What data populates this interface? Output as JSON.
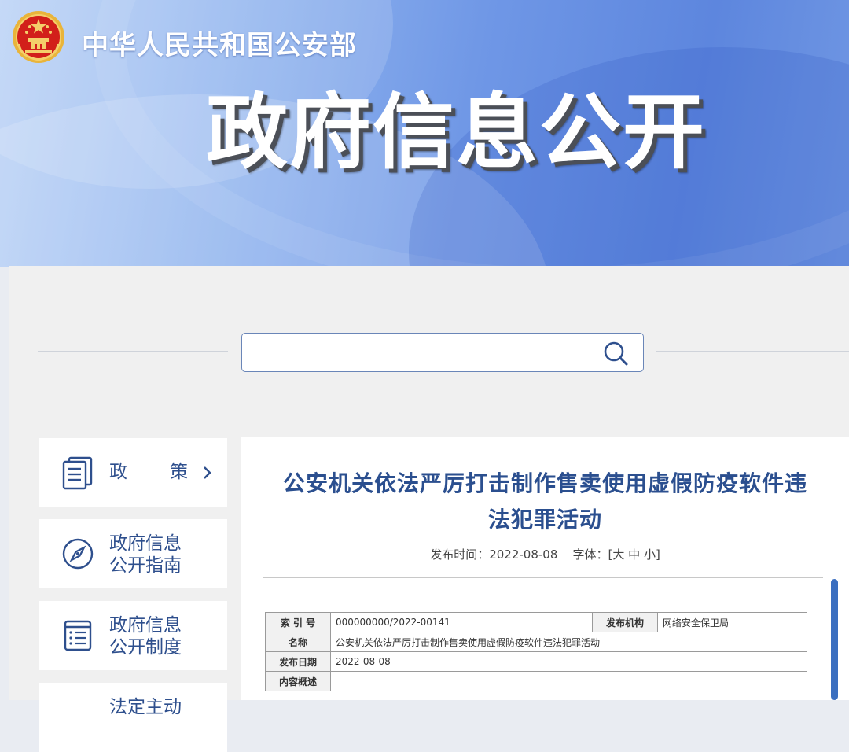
{
  "header": {
    "site_name": "中华人民共和国公安部",
    "banner_title": "政府信息公开"
  },
  "search": {
    "placeholder": ""
  },
  "nav": {
    "items": [
      {
        "label_parts": [
          "政",
          "策"
        ]
      },
      {
        "line1": "政府信息",
        "line2": "公开指南"
      },
      {
        "line1": "政府信息",
        "line2": "公开制度"
      },
      {
        "line1": "法定主动"
      }
    ]
  },
  "article": {
    "title_line1": "公安机关依法严厉打击制作售卖使用虚假防疫软件违",
    "title_line2": "法犯罪活动",
    "meta": {
      "publish_label": "发布时间：",
      "publish_date": "2022-08-08",
      "font_label": "字体：",
      "bracket_open": "[",
      "font_large": "大",
      "font_medium": "中",
      "font_small": "小",
      "bracket_close": "]"
    },
    "info_table": {
      "index_label": "索 引 号",
      "index_value": "000000000/2022-00141",
      "org_label": "发布机构",
      "org_value": "网络安全保卫局",
      "name_label": "名称",
      "name_value": "公安机关依法严厉打击制作售卖使用虚假防疫软件违法犯罪活动",
      "date_label": "发布日期",
      "date_value": "2022-08-08",
      "summary_label": "内容概述",
      "summary_value": ""
    }
  },
  "colors": {
    "brand_blue": "#2e4f8d",
    "title_blue": "#2b4f8f",
    "emblem_red": "#d21f1a",
    "emblem_gold": "#e9b43a"
  }
}
